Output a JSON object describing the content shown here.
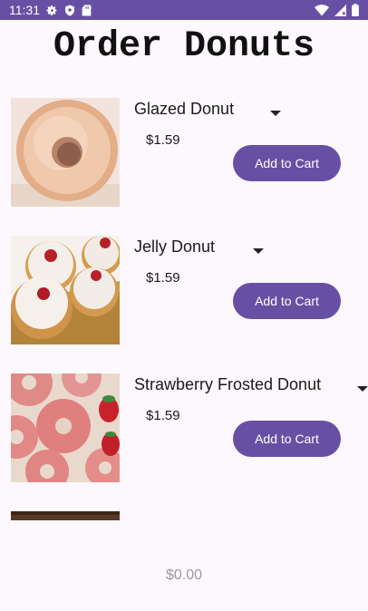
{
  "status_bar": {
    "time": "11:31",
    "left_icons": [
      "settings-icon",
      "shield-icon",
      "sd-card-icon"
    ],
    "right_icons": [
      "wifi-icon",
      "signal-icon",
      "battery-icon"
    ]
  },
  "page": {
    "title": "Order Donuts"
  },
  "items": [
    {
      "name": "Glazed Donut",
      "price": "$1.59",
      "button_label": "Add to Cart"
    },
    {
      "name": "Jelly Donut",
      "price": "$1.59",
      "button_label": "Add to Cart"
    },
    {
      "name": "Strawberry Frosted Donut",
      "price": "$1.59",
      "button_label": "Add to Cart"
    },
    {
      "name": ""
    }
  ],
  "footer": {
    "total": "$0.00"
  },
  "colors": {
    "accent": "#6750a4",
    "background": "#fdf8fd"
  }
}
